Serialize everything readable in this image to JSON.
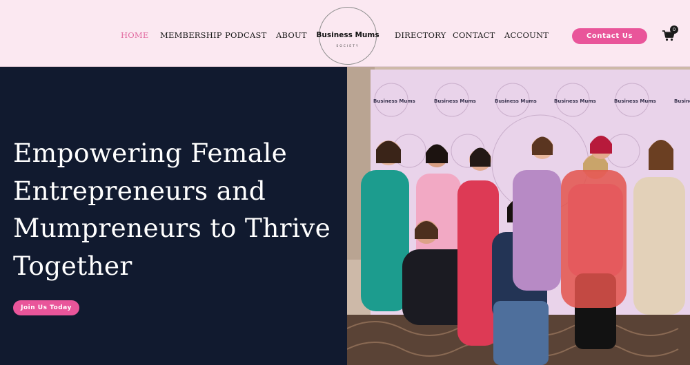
{
  "nav": {
    "items": [
      {
        "label": "HOME",
        "active": true
      },
      {
        "label": "MEMBERSHIP"
      },
      {
        "label": "PODCAST"
      },
      {
        "label": "ABOUT"
      },
      {
        "label": "DIRECTORY"
      },
      {
        "label": "CONTACT"
      },
      {
        "label": "ACCOUNT"
      }
    ],
    "active_color": "#e26aa0"
  },
  "logo": {
    "name": "Business Mums",
    "sub": "SOCIETY"
  },
  "header": {
    "contact_button": "Contact Us",
    "cart_icon": "shopping-cart-icon",
    "cart_count": "0"
  },
  "hero": {
    "title": "Empowering Female Entrepreneurs and Mumpreneurs to Thrive Together",
    "cta": "Join Us Today",
    "photo_backdrop_text": "Business Mums"
  },
  "colors": {
    "brand_pink": "#e9559a",
    "header_bg": "#fbe8f1",
    "hero_bg": "#111a2f"
  }
}
